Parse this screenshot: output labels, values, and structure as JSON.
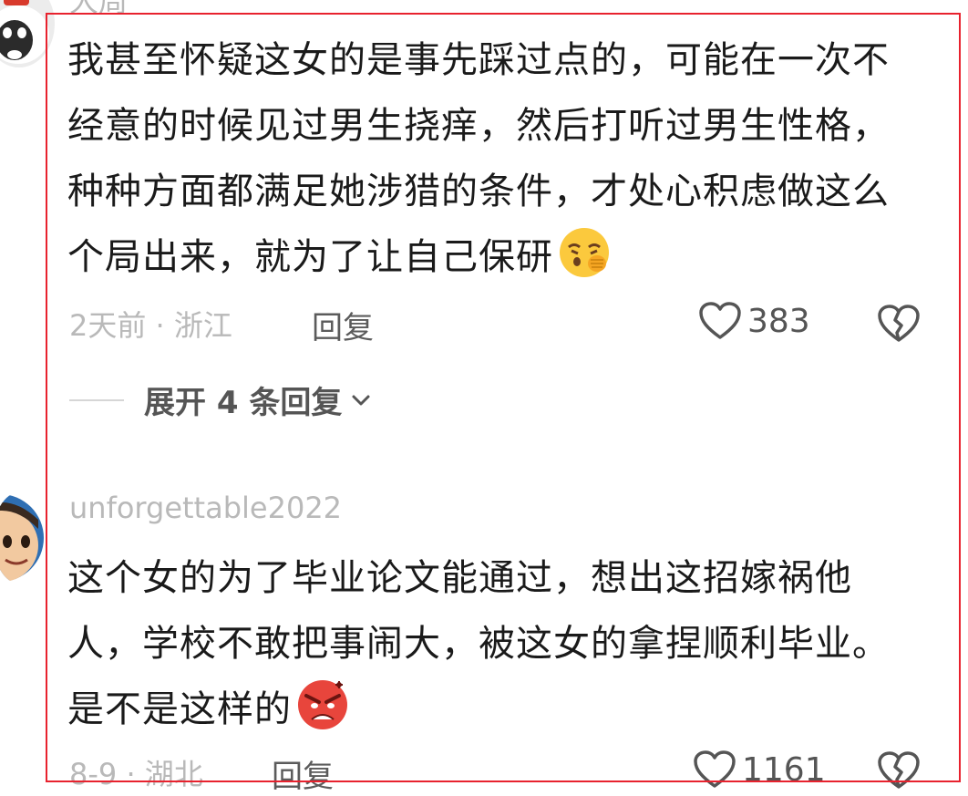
{
  "comments": [
    {
      "username": "大周",
      "text": "我甚至怀疑这女的是事先踩过点的，可能在一次不经意的时候见过男生挠痒，然后打听过男生性格，种种方面都满足她涉猎的条件，才处心积虑做这么个局出来，就为了让自己保研",
      "emoji": "face-with-tears-and-hand-emoji",
      "meta": "2天前 · 浙江",
      "reply_label": "回复",
      "likes": "383",
      "expand_label": "展开 4 条回复"
    },
    {
      "username": "unforgettable2022",
      "text": "这个女的为了毕业论文能通过，想出这招嫁祸他人，学校不敢把事闹大，被这女的拿捏顺利毕业。是不是这样的",
      "emoji": "angry-face-emoji",
      "meta": "8-9 · 湖北",
      "reply_label": "回复",
      "likes": "1161"
    }
  ],
  "colors": {
    "highlight_border": "#e8222e",
    "meta_gray": "#b9b9b9",
    "text": "#1a1a1a"
  }
}
